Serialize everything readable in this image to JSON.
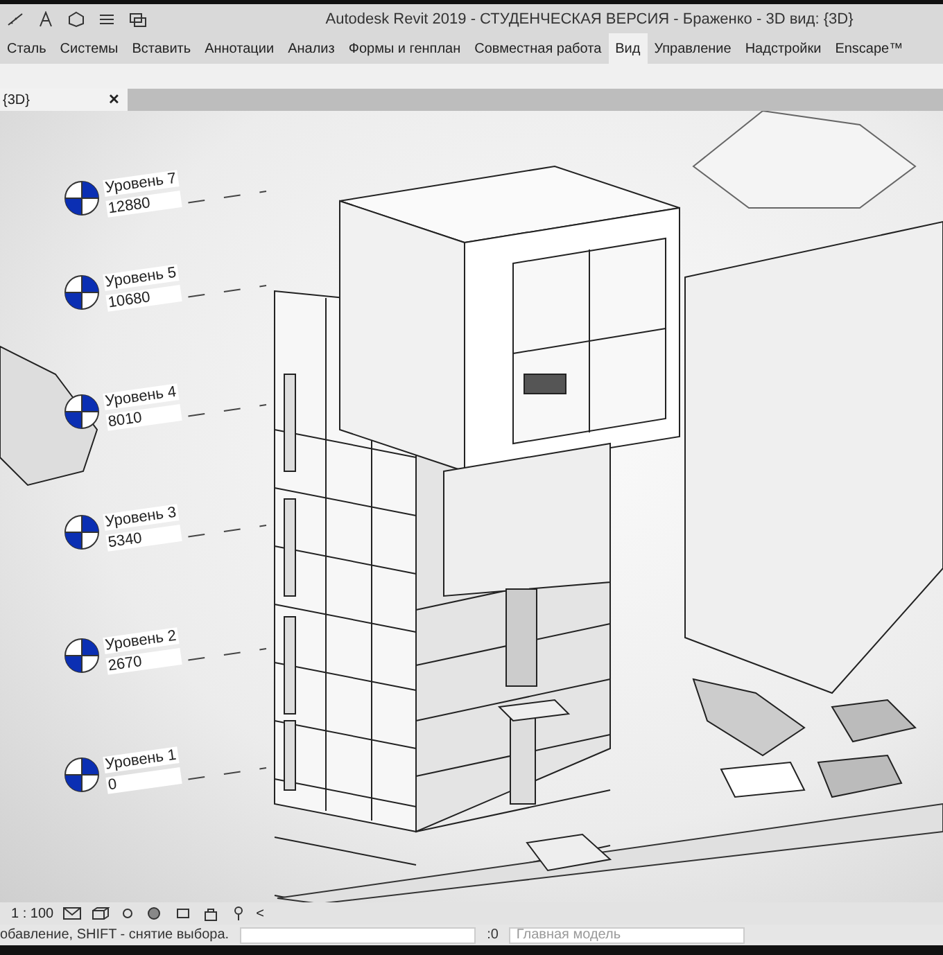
{
  "window": {
    "title": "Autodesk Revit 2019 - СТУДЕНЧЕСКАЯ ВЕРСИЯ - Браженко - 3D вид: {3D}"
  },
  "ribbon_tabs": [
    {
      "label": "Сталь",
      "selected": false
    },
    {
      "label": "Системы",
      "selected": false
    },
    {
      "label": "Вставить",
      "selected": false
    },
    {
      "label": "Аннотации",
      "selected": false
    },
    {
      "label": "Анализ",
      "selected": false
    },
    {
      "label": "Формы и генплан",
      "selected": false
    },
    {
      "label": "Совместная работа",
      "selected": false
    },
    {
      "label": "Вид",
      "selected": true
    },
    {
      "label": "Управление",
      "selected": false
    },
    {
      "label": "Надстройки",
      "selected": false
    },
    {
      "label": "Enscape™",
      "selected": false
    }
  ],
  "view_tab": {
    "label": "{3D}",
    "close": "✕"
  },
  "levels": [
    {
      "name": "Уровень 7",
      "elevation": "12880"
    },
    {
      "name": "Уровень 5",
      "elevation": "10680"
    },
    {
      "name": "Уровень 4",
      "elevation": "8010"
    },
    {
      "name": "Уровень 3",
      "elevation": "5340"
    },
    {
      "name": "Уровень 2",
      "elevation": "2670"
    },
    {
      "name": "Уровень 1",
      "elevation": "0"
    }
  ],
  "view_control_bar": {
    "scale": "1 : 100",
    "more": "<"
  },
  "status_bar": {
    "message": "обавление, SHIFT - снятие выбора.",
    "filter_count": ":0",
    "model": "Главная модель"
  }
}
